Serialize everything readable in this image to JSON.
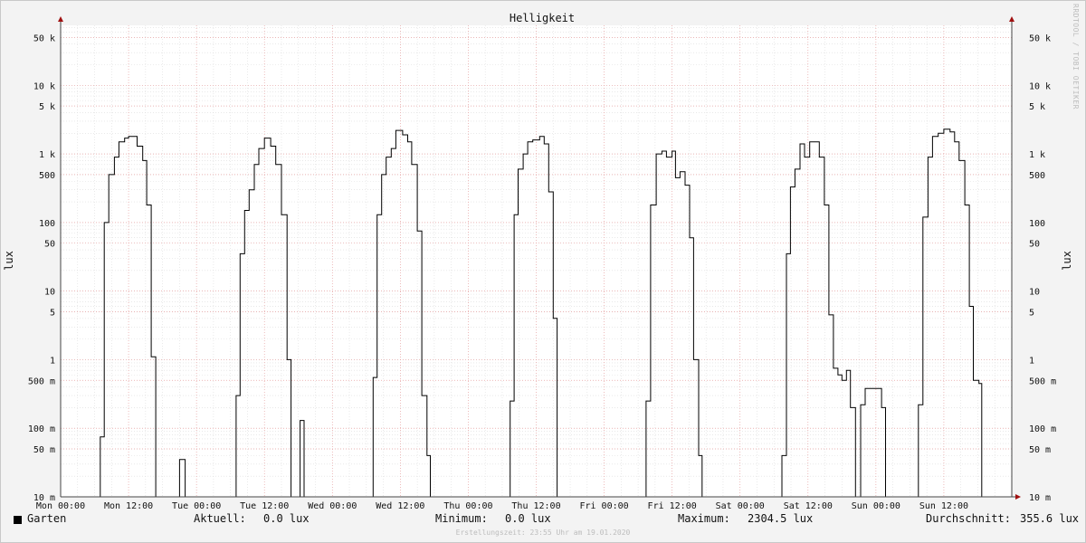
{
  "chart_data": {
    "type": "line",
    "title": "Helligkeit",
    "ylabel": "lux",
    "y_scale": "log",
    "ylim": [
      0.01,
      75000
    ],
    "y_ticks": [
      {
        "value": 50000,
        "label": "50 k"
      },
      {
        "value": 10000,
        "label": "10 k"
      },
      {
        "value": 5000,
        "label": "5 k"
      },
      {
        "value": 1000,
        "label": "1 k"
      },
      {
        "value": 500,
        "label": "500"
      },
      {
        "value": 100,
        "label": "100"
      },
      {
        "value": 50,
        "label": "50"
      },
      {
        "value": 10,
        "label": "10"
      },
      {
        "value": 5,
        "label": "5"
      },
      {
        "value": 1,
        "label": "1"
      },
      {
        "value": 0.5,
        "label": "500 m"
      },
      {
        "value": 0.1,
        "label": "100 m"
      },
      {
        "value": 0.05,
        "label": "50 m"
      },
      {
        "value": 0.01,
        "label": "10 m"
      }
    ],
    "x_unit": "hours since Mon 00:00",
    "xlim": [
      0,
      168
    ],
    "x_ticks": [
      {
        "value": 0,
        "label": "Mon 00:00"
      },
      {
        "value": 12,
        "label": "Mon 12:00"
      },
      {
        "value": 24,
        "label": "Tue 00:00"
      },
      {
        "value": 36,
        "label": "Tue 12:00"
      },
      {
        "value": 48,
        "label": "Wed 00:00"
      },
      {
        "value": 60,
        "label": "Wed 12:00"
      },
      {
        "value": 72,
        "label": "Thu 00:00"
      },
      {
        "value": 84,
        "label": "Thu 12:00"
      },
      {
        "value": 96,
        "label": "Fri 00:00"
      },
      {
        "value": 108,
        "label": "Fri 12:00"
      },
      {
        "value": 120,
        "label": "Sat 00:00"
      },
      {
        "value": 132,
        "label": "Sat 12:00"
      },
      {
        "value": 144,
        "label": "Sun 00:00"
      },
      {
        "value": 156,
        "label": "Sun 12:00"
      }
    ],
    "grid": true,
    "series": [
      {
        "name": "Garten",
        "color": "#000000",
        "points": [
          [
            0,
            0.01
          ],
          [
            7,
            0.01
          ],
          [
            7,
            0.075
          ],
          [
            7.7,
            0.075
          ],
          [
            7.7,
            100
          ],
          [
            8.5,
            100
          ],
          [
            8.5,
            500
          ],
          [
            9.5,
            500
          ],
          [
            9.5,
            900
          ],
          [
            10.3,
            900
          ],
          [
            10.3,
            1500
          ],
          [
            11.3,
            1500
          ],
          [
            11.3,
            1700
          ],
          [
            12,
            1700
          ],
          [
            12,
            1800
          ],
          [
            13.5,
            1800
          ],
          [
            13.5,
            1300
          ],
          [
            14.5,
            1300
          ],
          [
            14.5,
            800
          ],
          [
            15.2,
            800
          ],
          [
            15.2,
            180
          ],
          [
            16,
            180
          ],
          [
            16,
            1.1
          ],
          [
            16.8,
            1.1
          ],
          [
            16.8,
            0.01
          ],
          [
            21,
            0.01
          ],
          [
            21,
            0.035
          ],
          [
            22,
            0.035
          ],
          [
            22,
            0.01
          ],
          [
            31,
            0.01
          ],
          [
            31,
            0.3
          ],
          [
            31.7,
            0.3
          ],
          [
            31.7,
            35
          ],
          [
            32.5,
            35
          ],
          [
            32.5,
            150
          ],
          [
            33.3,
            150
          ],
          [
            33.3,
            300
          ],
          [
            34.2,
            300
          ],
          [
            34.2,
            700
          ],
          [
            35,
            700
          ],
          [
            35,
            1200
          ],
          [
            36,
            1200
          ],
          [
            36,
            1700
          ],
          [
            37.1,
            1700
          ],
          [
            37.1,
            1300
          ],
          [
            38,
            1300
          ],
          [
            38,
            700
          ],
          [
            39,
            700
          ],
          [
            39,
            130
          ],
          [
            40,
            130
          ],
          [
            40,
            1
          ],
          [
            40.7,
            1
          ],
          [
            40.7,
            0.01
          ],
          [
            42.3,
            0.01
          ],
          [
            42.3,
            0.13
          ],
          [
            43,
            0.13
          ],
          [
            43,
            0.01
          ],
          [
            55.2,
            0.01
          ],
          [
            55.2,
            0.55
          ],
          [
            55.9,
            0.55
          ],
          [
            55.9,
            130
          ],
          [
            56.7,
            130
          ],
          [
            56.7,
            500
          ],
          [
            57.5,
            500
          ],
          [
            57.5,
            900
          ],
          [
            58.4,
            900
          ],
          [
            58.4,
            1200
          ],
          [
            59.2,
            1200
          ],
          [
            59.2,
            2200
          ],
          [
            60.4,
            2200
          ],
          [
            60.4,
            1900
          ],
          [
            61.3,
            1900
          ],
          [
            61.3,
            1500
          ],
          [
            62,
            1500
          ],
          [
            62,
            700
          ],
          [
            63,
            700
          ],
          [
            63,
            75
          ],
          [
            63.8,
            75
          ],
          [
            63.8,
            0.3
          ],
          [
            64.7,
            0.3
          ],
          [
            64.7,
            0.04
          ],
          [
            65.3,
            0.04
          ],
          [
            65.3,
            0.01
          ],
          [
            79.4,
            0.01
          ],
          [
            79.4,
            0.25
          ],
          [
            80.1,
            0.25
          ],
          [
            80.1,
            130
          ],
          [
            80.8,
            130
          ],
          [
            80.8,
            600
          ],
          [
            81.7,
            600
          ],
          [
            81.7,
            1000
          ],
          [
            82.5,
            1000
          ],
          [
            82.5,
            1500
          ],
          [
            83.4,
            1500
          ],
          [
            83.4,
            1600
          ],
          [
            84.6,
            1600
          ],
          [
            84.6,
            1800
          ],
          [
            85.4,
            1800
          ],
          [
            85.4,
            1400
          ],
          [
            86.2,
            1400
          ],
          [
            86.2,
            280
          ],
          [
            87,
            280
          ],
          [
            87,
            4
          ],
          [
            87.7,
            4
          ],
          [
            87.7,
            0.01
          ],
          [
            103.4,
            0.01
          ],
          [
            103.4,
            0.25
          ],
          [
            104.2,
            0.25
          ],
          [
            104.2,
            180
          ],
          [
            105.2,
            180
          ],
          [
            105.2,
            1000
          ],
          [
            106.2,
            1000
          ],
          [
            106.2,
            1100
          ],
          [
            107,
            1100
          ],
          [
            107,
            900
          ],
          [
            108,
            900
          ],
          [
            108,
            1100
          ],
          [
            108.6,
            1100
          ],
          [
            108.6,
            450
          ],
          [
            109.4,
            450
          ],
          [
            109.4,
            550
          ],
          [
            110.3,
            550
          ],
          [
            110.3,
            350
          ],
          [
            111.1,
            350
          ],
          [
            111.1,
            60
          ],
          [
            111.8,
            60
          ],
          [
            111.8,
            1
          ],
          [
            112.7,
            1
          ],
          [
            112.7,
            0.04
          ],
          [
            113.3,
            0.04
          ],
          [
            113.3,
            0.01
          ],
          [
            127.4,
            0.01
          ],
          [
            127.4,
            0.04
          ],
          [
            128.2,
            0.04
          ],
          [
            128.2,
            35
          ],
          [
            128.9,
            35
          ],
          [
            128.9,
            330
          ],
          [
            129.7,
            330
          ],
          [
            129.7,
            600
          ],
          [
            130.6,
            600
          ],
          [
            130.6,
            1400
          ],
          [
            131.4,
            1400
          ],
          [
            131.4,
            900
          ],
          [
            132.3,
            900
          ],
          [
            132.3,
            1500
          ],
          [
            134,
            1500
          ],
          [
            134,
            900
          ],
          [
            134.9,
            900
          ],
          [
            134.9,
            180
          ],
          [
            135.7,
            180
          ],
          [
            135.7,
            4.5
          ],
          [
            136.5,
            4.5
          ],
          [
            136.5,
            0.75
          ],
          [
            137.3,
            0.75
          ],
          [
            137.3,
            0.6
          ],
          [
            138,
            0.6
          ],
          [
            138,
            0.5
          ],
          [
            138.8,
            0.5
          ],
          [
            138.8,
            0.7
          ],
          [
            139.5,
            0.7
          ],
          [
            139.5,
            0.2
          ],
          [
            140.4,
            0.2
          ],
          [
            140.4,
            0.01
          ],
          [
            141.3,
            0.01
          ],
          [
            141.3,
            0.22
          ],
          [
            142.1,
            0.22
          ],
          [
            142.1,
            0.38
          ],
          [
            145,
            0.38
          ],
          [
            145,
            0.2
          ],
          [
            145.7,
            0.2
          ],
          [
            145.7,
            0.01
          ],
          [
            151.5,
            0.01
          ],
          [
            151.5,
            0.22
          ],
          [
            152.3,
            0.22
          ],
          [
            152.3,
            120
          ],
          [
            153.2,
            120
          ],
          [
            153.2,
            900
          ],
          [
            154,
            900
          ],
          [
            154,
            1800
          ],
          [
            155,
            1800
          ],
          [
            155,
            2000
          ],
          [
            156,
            2000
          ],
          [
            156,
            2300
          ],
          [
            157.1,
            2300
          ],
          [
            157.1,
            2100
          ],
          [
            157.9,
            2100
          ],
          [
            157.9,
            1500
          ],
          [
            158.7,
            1500
          ],
          [
            158.7,
            800
          ],
          [
            159.7,
            800
          ],
          [
            159.7,
            180
          ],
          [
            160.5,
            180
          ],
          [
            160.5,
            6
          ],
          [
            161.2,
            6
          ],
          [
            161.2,
            0.5
          ],
          [
            162.2,
            0.5
          ],
          [
            162.2,
            0.45
          ],
          [
            162.7,
            0.45
          ],
          [
            162.7,
            0.01
          ],
          [
            168,
            0.01
          ]
        ]
      }
    ]
  },
  "legend": {
    "series_name": "Garten",
    "current_label": "Aktuell:",
    "current_value": "0.0 lux",
    "min_label": "Minimum:",
    "min_value": "0.0 lux",
    "max_label": "Maximum:",
    "max_value": "2304.5 lux",
    "avg_label": "Durchschnitt:",
    "avg_value": "355.6 lux"
  },
  "footer": "Erstellungszeit: 23:55 Uhr am 19.01.2020",
  "watermark": "RRDTOOL / TOBI OETIKER"
}
